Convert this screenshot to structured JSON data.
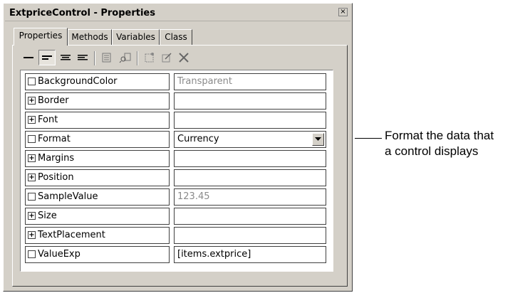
{
  "window": {
    "title": "ExtpriceControl - Properties",
    "close_glyph": "×"
  },
  "tabs": [
    {
      "label": "Properties",
      "active": true
    },
    {
      "label": "Methods",
      "active": false
    },
    {
      "label": "Variables",
      "active": false
    },
    {
      "label": "Class",
      "active": false
    }
  ],
  "toolbar": {
    "buttons": [
      "align-none-icon",
      "align-left-icon",
      "align-center-icon",
      "align-justify-icon",
      "sort-icon",
      "find-icon",
      "paste-icon",
      "edit-icon",
      "delete-icon"
    ]
  },
  "properties": [
    {
      "name": "BackgroundColor",
      "expandable": false,
      "value": "Transparent",
      "value_style": "dim"
    },
    {
      "name": "Border",
      "expandable": true,
      "value": "",
      "value_style": "dark"
    },
    {
      "name": "Font",
      "expandable": true,
      "value": "",
      "value_style": "dark"
    },
    {
      "name": "Format",
      "expandable": false,
      "value": "Currency",
      "value_style": "dark",
      "dropdown": true
    },
    {
      "name": "Margins",
      "expandable": true,
      "value": "",
      "value_style": "dark"
    },
    {
      "name": "Position",
      "expandable": true,
      "value": "",
      "value_style": "dark"
    },
    {
      "name": "SampleValue",
      "expandable": false,
      "value": "123.45",
      "value_style": "dim"
    },
    {
      "name": "Size",
      "expandable": true,
      "value": "",
      "value_style": "dark"
    },
    {
      "name": "TextPlacement",
      "expandable": true,
      "value": "",
      "value_style": "dark"
    },
    {
      "name": "ValueExp",
      "expandable": false,
      "value": "[items.extprice]",
      "value_style": "dark"
    }
  ],
  "callout": {
    "line1": "Format the data that",
    "line2": "a control displays"
  }
}
